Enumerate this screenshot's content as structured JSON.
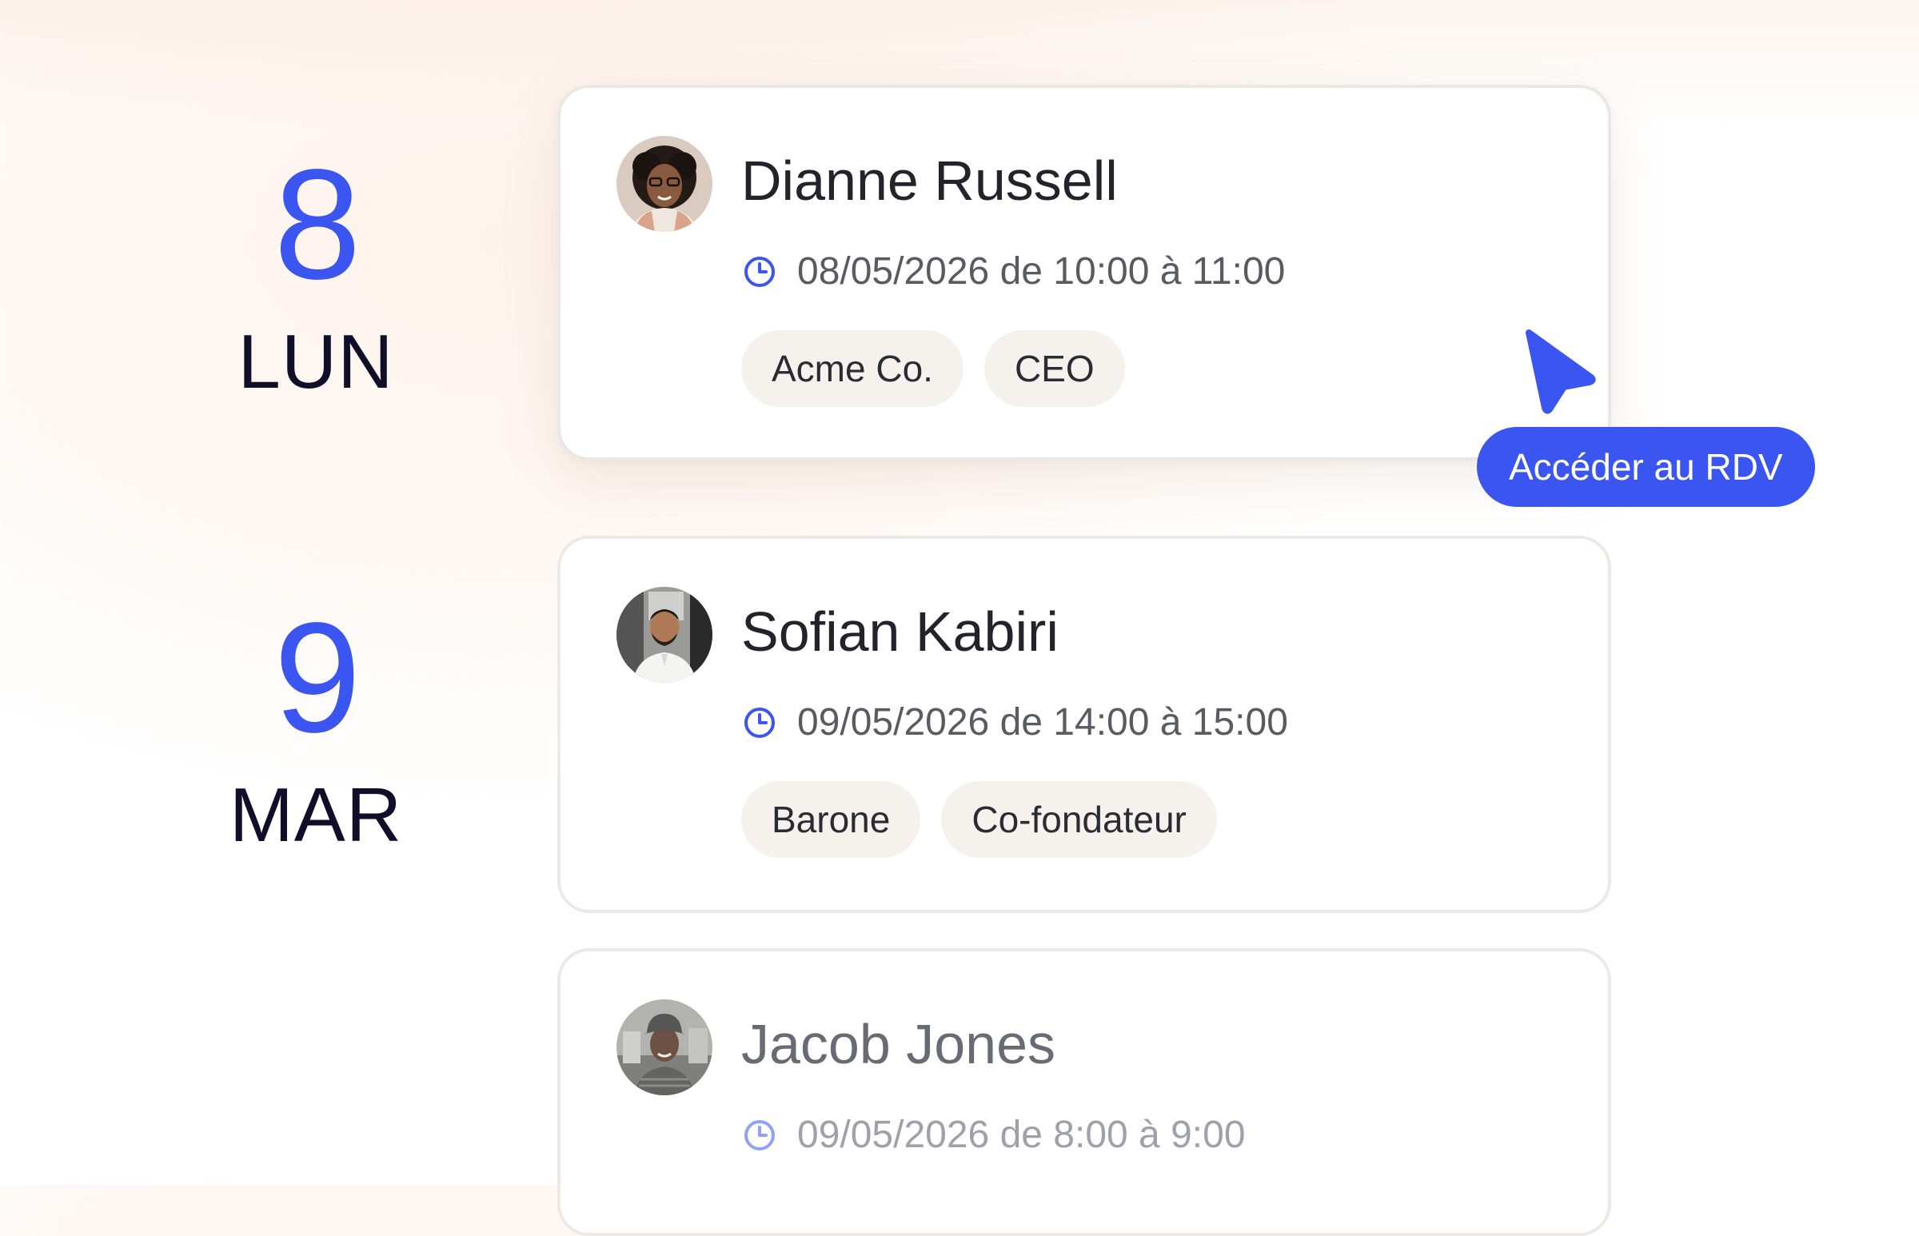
{
  "days": [
    {
      "number": "8",
      "weekday": "LUN"
    },
    {
      "number": "9",
      "weekday": "MAR"
    }
  ],
  "appointments": [
    {
      "name": "Dianne Russell",
      "time": "08/05/2026 de 10:00 à 11:00",
      "tags": [
        "Acme Co.",
        "CEO"
      ]
    },
    {
      "name": "Sofian Kabiri",
      "time": "09/05/2026 de 14:00 à 15:00",
      "tags": [
        "Barone",
        "Co-fondateur"
      ]
    },
    {
      "name": "Jacob Jones",
      "time": "09/05/2026 de 8:00 à 9:00"
    }
  ],
  "cta": {
    "label": "Accéder au RDV"
  },
  "colors": {
    "accent": "#3a55f0",
    "tag_bg": "#f5f1ec",
    "text_dark": "#0f0f2a"
  },
  "icons": {
    "time": "clock-icon",
    "pointer": "cursor-icon"
  }
}
